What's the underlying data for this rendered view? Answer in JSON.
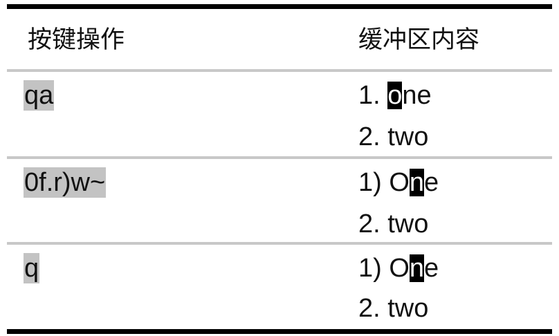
{
  "header": {
    "col1": "按键操作",
    "col2": "缓冲区内容"
  },
  "rows": [
    {
      "keys": "qa",
      "line1": {
        "prefix": "1. ",
        "cursor": "o",
        "suffix": "ne"
      },
      "line2": "2. two"
    },
    {
      "keys": "0f.r)w~",
      "line1": {
        "prefix": "1) O",
        "cursor": "n",
        "suffix": "e"
      },
      "line2": "2. two"
    },
    {
      "keys": "q",
      "line1": {
        "prefix": "1) O",
        "cursor": "n",
        "suffix": "e"
      },
      "line2": "2. two"
    }
  ]
}
